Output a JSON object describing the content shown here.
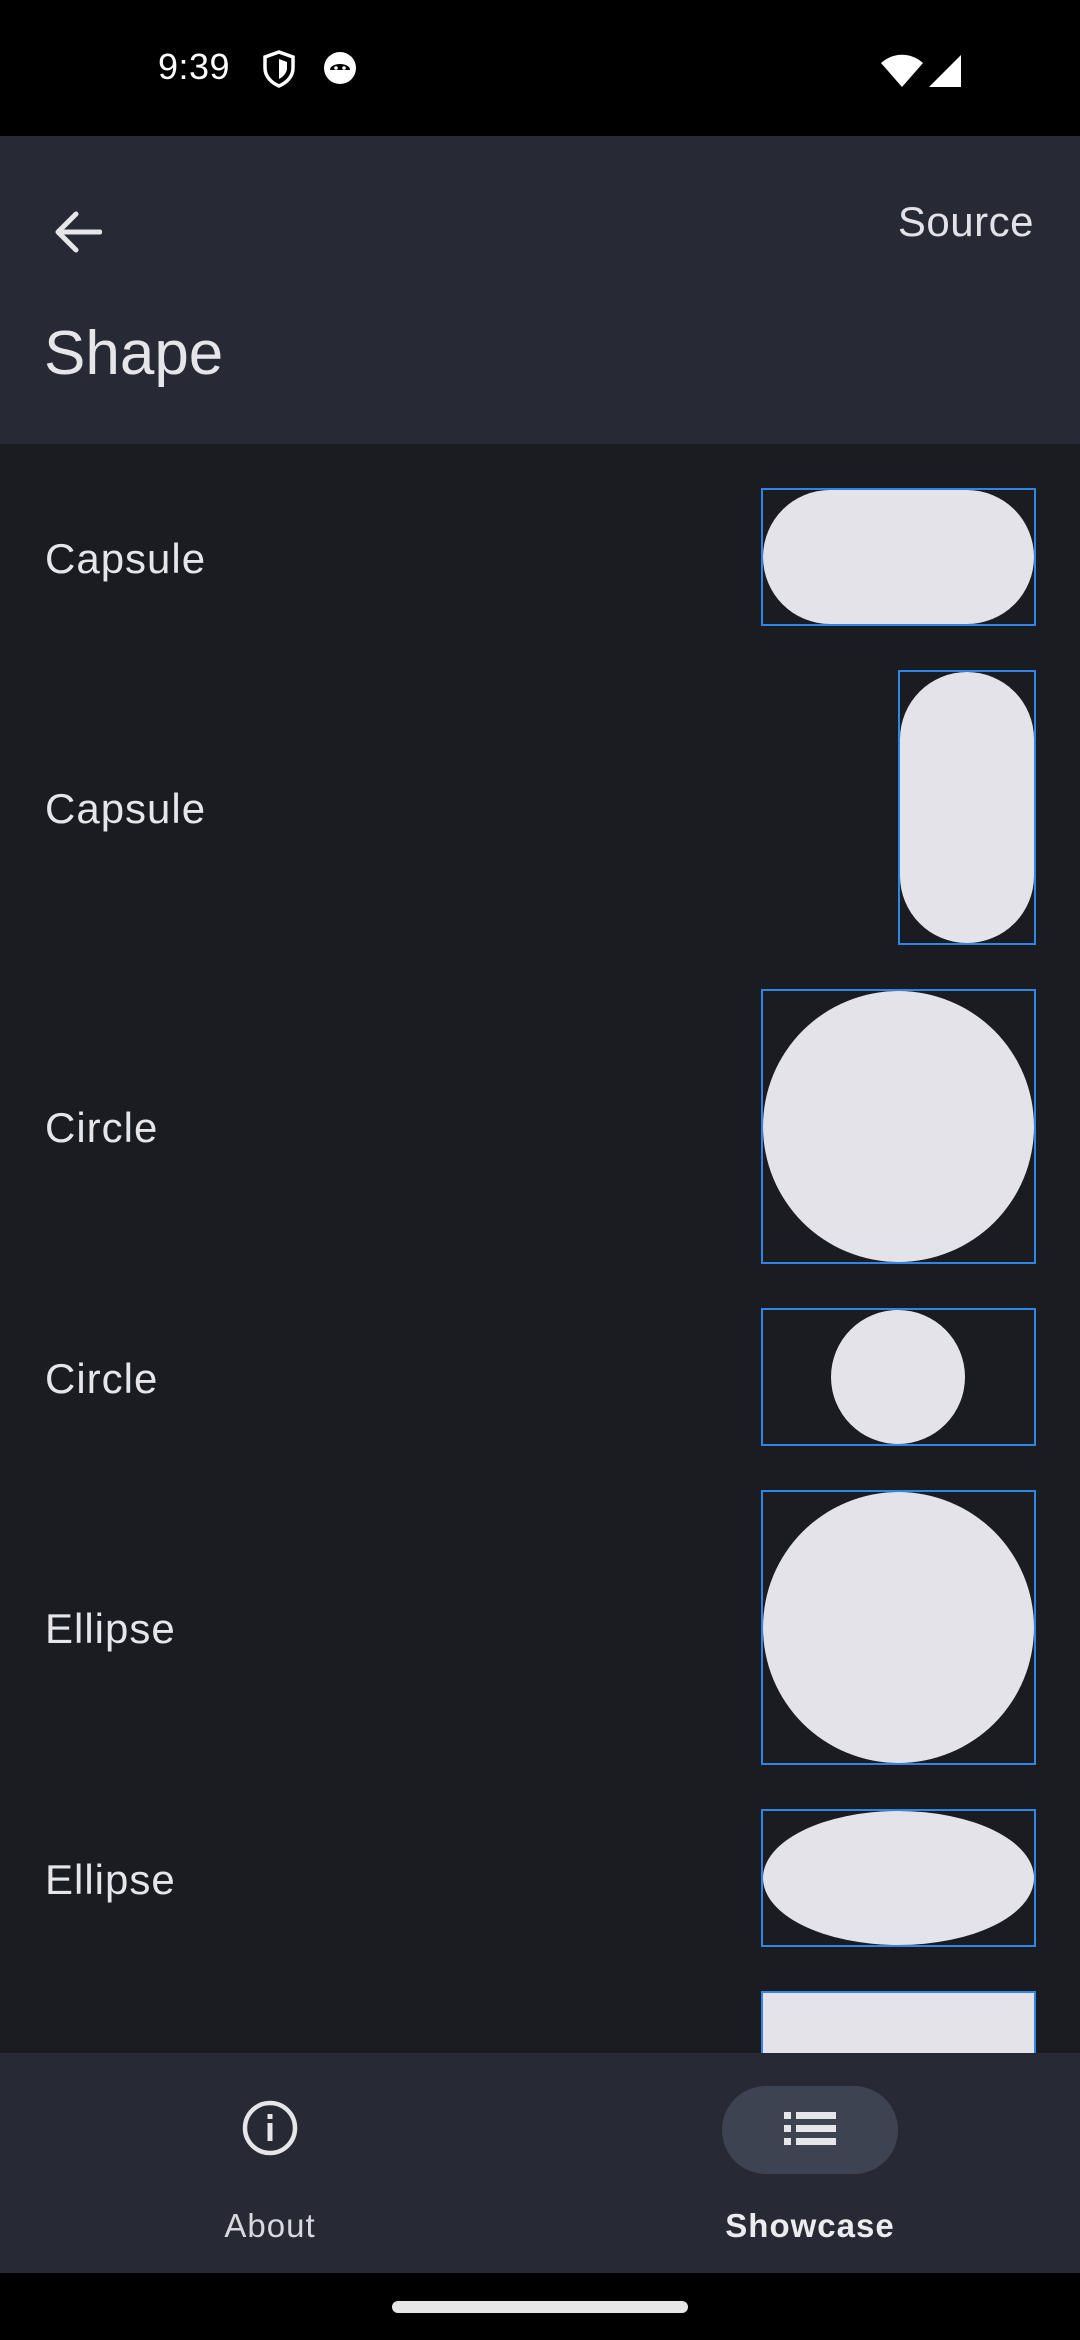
{
  "status_bar": {
    "time": "9:39",
    "icons": [
      "shield-icon",
      "android-debug-icon",
      "wifi-icon",
      "signal-icon"
    ]
  },
  "app_bar": {
    "back_icon": "arrow-back-icon",
    "action_label": "Source",
    "title": "Shape"
  },
  "rows": [
    {
      "label": "Capsule",
      "shape": "capsule-horizontal"
    },
    {
      "label": "Capsule",
      "shape": "capsule-vertical"
    },
    {
      "label": "Circle",
      "shape": "circle-in-square"
    },
    {
      "label": "Circle",
      "shape": "circle-in-wide-rect"
    },
    {
      "label": "Ellipse",
      "shape": "ellipse-in-square"
    },
    {
      "label": "Ellipse",
      "shape": "ellipse-in-wide-rect"
    },
    {
      "label": "",
      "shape": "rectangle"
    }
  ],
  "bottom_nav": {
    "items": [
      {
        "label": "About",
        "icon": "info-icon",
        "active": false
      },
      {
        "label": "Showcase",
        "icon": "list-icon",
        "active": true
      }
    ]
  },
  "colors": {
    "background": "#1b1c21",
    "app_bar": "#272a34",
    "frame_border": "#2f86e8",
    "shape_fill": "#e3e3e9",
    "active_pill": "#3e4352"
  }
}
